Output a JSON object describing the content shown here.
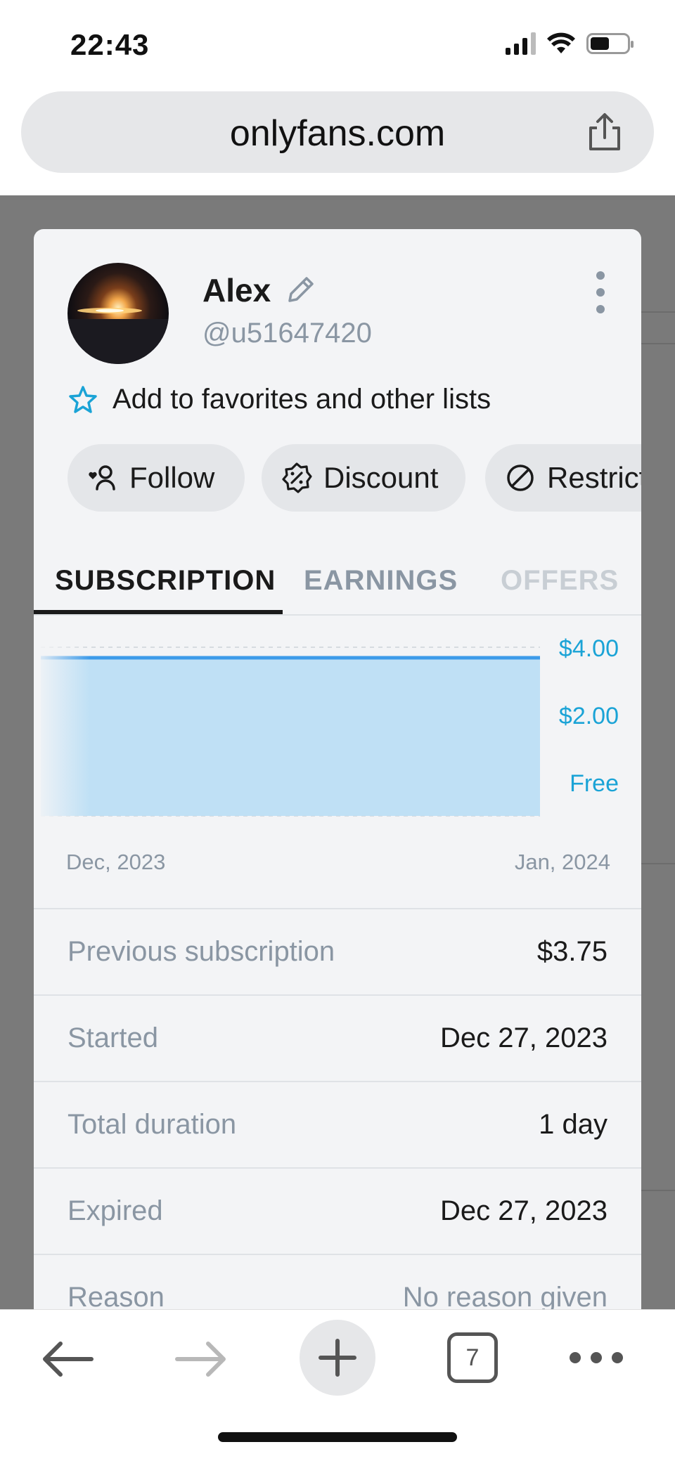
{
  "status_bar": {
    "time": "22:43"
  },
  "browser": {
    "url": "onlyfans.com",
    "tab_count": "7"
  },
  "profile": {
    "name": "Alex",
    "handle": "@u51647420",
    "favorites_label": "Add to favorites and other lists"
  },
  "actions": {
    "follow": "Follow",
    "discount": "Discount",
    "restrict": "Restrict"
  },
  "tabs": [
    {
      "label": "SUBSCRIPTION",
      "active": true
    },
    {
      "label": "EARNINGS",
      "active": false
    },
    {
      "label": "OFFERS",
      "active": false
    }
  ],
  "chart_data": {
    "type": "area",
    "x": [
      "Dec, 2023",
      "Jan, 2024"
    ],
    "series": [
      {
        "values": [
          3.75,
          3.75
        ]
      }
    ],
    "y_tick_labels": [
      "$4.00",
      "$2.00",
      "Free"
    ],
    "ylim": [
      0,
      4
    ],
    "grid": true,
    "accent_color": "#1aa3d6",
    "fill_color": "#bfe0f5"
  },
  "details": [
    {
      "label": "Previous subscription",
      "value": "$3.75"
    },
    {
      "label": "Started",
      "value": "Dec 27, 2023"
    },
    {
      "label": "Total duration",
      "value": "1 day"
    },
    {
      "label": "Expired",
      "value": "Dec 27, 2023"
    },
    {
      "label": "Reason",
      "value": "No reason given"
    }
  ],
  "icons": {
    "edit": "pencil-icon",
    "more": "more-vertical-icon",
    "favorite": "star-icon",
    "follow": "user-heart-icon",
    "discount": "badge-percent-icon",
    "restrict": "block-icon",
    "share": "share-icon",
    "back": "arrow-left-icon",
    "forward": "arrow-right-icon",
    "new_tab": "plus-icon",
    "menu": "more-horizontal-icon"
  }
}
